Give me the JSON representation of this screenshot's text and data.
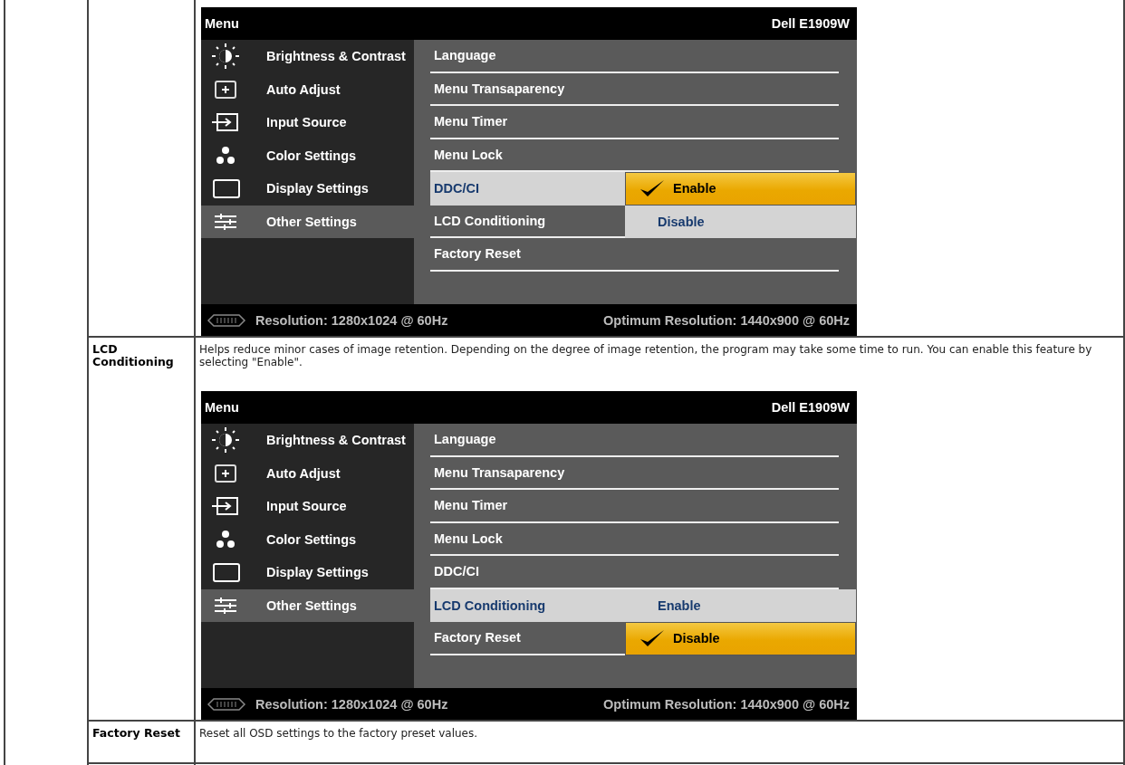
{
  "rows": [
    {
      "osd": {
        "title": "Menu",
        "model": "Dell E1909W",
        "categories": [
          {
            "label": "Brightness & Contrast",
            "selected": false
          },
          {
            "label": "Auto Adjust",
            "selected": false
          },
          {
            "label": "Input Source",
            "selected": false
          },
          {
            "label": "Color Settings",
            "selected": false
          },
          {
            "label": "Display Settings",
            "selected": false
          },
          {
            "label": "Other Settings",
            "selected": true
          }
        ],
        "settings": [
          {
            "label": "Language",
            "highlighted": false
          },
          {
            "label": "Menu Transaparency",
            "highlighted": false
          },
          {
            "label": "Menu Timer",
            "highlighted": false
          },
          {
            "label": "Menu Lock",
            "highlighted": false
          },
          {
            "label": "DDC/CI",
            "highlighted": true,
            "options": [
              {
                "label": "Enable",
                "selected": true
              },
              {
                "label": "Disable",
                "selected": false
              }
            ]
          },
          {
            "label": "LCD Conditioning",
            "highlighted": false
          },
          {
            "label": "Factory Reset",
            "highlighted": false
          }
        ],
        "resolution": "Resolution: 1280x1024 @ 60Hz",
        "optimum": "Optimum Resolution: 1440x900 @ 60Hz"
      }
    },
    {
      "label": "LCD Conditioning",
      "description": "Helps reduce minor cases of image retention. Depending on the degree of image retention, the program may take some time to run. You can enable this feature by selecting \"Enable\".",
      "osd": {
        "title": "Menu",
        "model": "Dell E1909W",
        "categories": [
          {
            "label": "Brightness & Contrast",
            "selected": false
          },
          {
            "label": "Auto Adjust",
            "selected": false
          },
          {
            "label": "Input Source",
            "selected": false
          },
          {
            "label": "Color Settings",
            "selected": false
          },
          {
            "label": "Display Settings",
            "selected": false
          },
          {
            "label": "Other Settings",
            "selected": true
          }
        ],
        "settings": [
          {
            "label": "Language",
            "highlighted": false
          },
          {
            "label": "Menu Transaparency",
            "highlighted": false
          },
          {
            "label": "Menu Timer",
            "highlighted": false
          },
          {
            "label": "Menu Lock",
            "highlighted": false
          },
          {
            "label": "DDC/CI",
            "highlighted": false
          },
          {
            "label": "LCD Conditioning",
            "highlighted": true,
            "options": [
              {
                "label": "Enable",
                "selected": false
              },
              {
                "label": "Disable",
                "selected": true
              }
            ]
          },
          {
            "label": "Factory Reset",
            "highlighted": false
          }
        ],
        "resolution": "Resolution: 1280x1024 @ 60Hz",
        "optimum": "Optimum Resolution: 1440x900 @ 60Hz"
      }
    },
    {
      "label": "Factory Reset",
      "description": "Reset all OSD settings to the factory preset values."
    }
  ]
}
